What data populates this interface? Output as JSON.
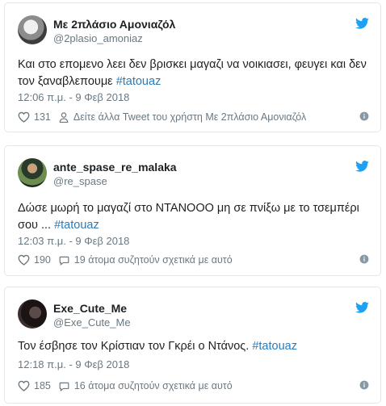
{
  "colors": {
    "link": "#2b7bb9",
    "secondary_text": "#697882",
    "twitter_blue": "#1da1f2",
    "border": "#e1e8ed"
  },
  "tweets": [
    {
      "name": "Με 2πλάσιο Αμονιαζόλ",
      "handle": "@2plasio_amoniaz",
      "text": "Και στο επομενο λεει δεν βρισκει μαγαζι να νοικιασει, φευγει και δεν τον ξαναβλεπουμε ",
      "hashtag": "#tatouaz",
      "timestamp": "12:06 π.μ. - 9 Φεβ 2018",
      "likes": "131",
      "people_text": "Δείτε άλλα Tweet του χρήστη Με 2πλάσιο Αμονιαζόλ",
      "avatar_icon": "user-avatar",
      "bird_icon": "twitter-bird-icon"
    },
    {
      "name": "ante_spase_re_malaka",
      "handle": "@re_spase",
      "text": "Δώσε μωρή το μαγαζί στο ΝΤΑΝΟΟΟ μη σε πνίξω με το τσεμπέρι σου ... ",
      "hashtag": "#tatouaz",
      "timestamp": "12:03 π.μ. - 9 Φεβ 2018",
      "likes": "190",
      "people_text": "19 άτομα συζητούν σχετικά με αυτό",
      "avatar_icon": "user-avatar",
      "bird_icon": "twitter-bird-icon"
    },
    {
      "name": "Exe_Cute_Me",
      "handle": "@Exe_Cute_Me",
      "text": "Τον έσβησε τον Κρίστιαν τον Γκρέι ο Ντάνος. ",
      "hashtag": "#tatouaz",
      "timestamp": "12:18 π.μ. - 9 Φεβ 2018",
      "likes": "185",
      "people_text": "16 άτομα συζητούν σχετικά με αυτό",
      "avatar_icon": "user-avatar",
      "bird_icon": "twitter-bird-icon"
    }
  ]
}
